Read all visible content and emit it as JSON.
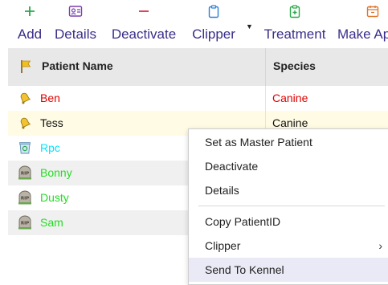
{
  "toolbar": {
    "add_label": "Add",
    "details_label": "Details",
    "deactivate_label": "Deactivate",
    "clipper_label": "Clipper",
    "treatment_label": "Treatment",
    "make_label": "Make Ap",
    "add_icon": "plus-icon",
    "details_icon": "id-card-icon",
    "deactivate_icon": "minus-icon",
    "clipper_icon": "clipboard-icon",
    "treatment_icon": "medical-clipboard-icon",
    "make_icon": "calendar-icon",
    "accent_color": "#3a2e8a"
  },
  "grid": {
    "header": {
      "name": "Patient Name",
      "species": "Species",
      "flag_icon": "flag-icon"
    },
    "rows": [
      {
        "name": "Ben",
        "species": "Canine",
        "icon": "bell-icon",
        "color": "#e00000"
      },
      {
        "name": "Tess",
        "species": "Canine",
        "icon": "bell-icon",
        "color": "#111111",
        "selected": true
      },
      {
        "name": "Rpc",
        "species": "",
        "icon": "recycle-bin-icon",
        "color": "#00e5ff"
      },
      {
        "name": "Bonny",
        "species": "",
        "icon": "rip-gravestone-icon",
        "color": "#22dd22"
      },
      {
        "name": "Dusty",
        "species": "",
        "icon": "rip-gravestone-icon",
        "color": "#22dd22"
      },
      {
        "name": "Sam",
        "species": "",
        "icon": "rip-gravestone-icon",
        "color": "#22dd22"
      }
    ]
  },
  "context_menu": {
    "items": [
      {
        "label": "Set as Master Patient"
      },
      {
        "label": "Deactivate"
      },
      {
        "label": "Details"
      },
      {
        "label": "Copy PatientID"
      },
      {
        "label": "Clipper",
        "submenu": true
      },
      {
        "label": "Send To Kennel",
        "highlighted": true
      }
    ]
  }
}
